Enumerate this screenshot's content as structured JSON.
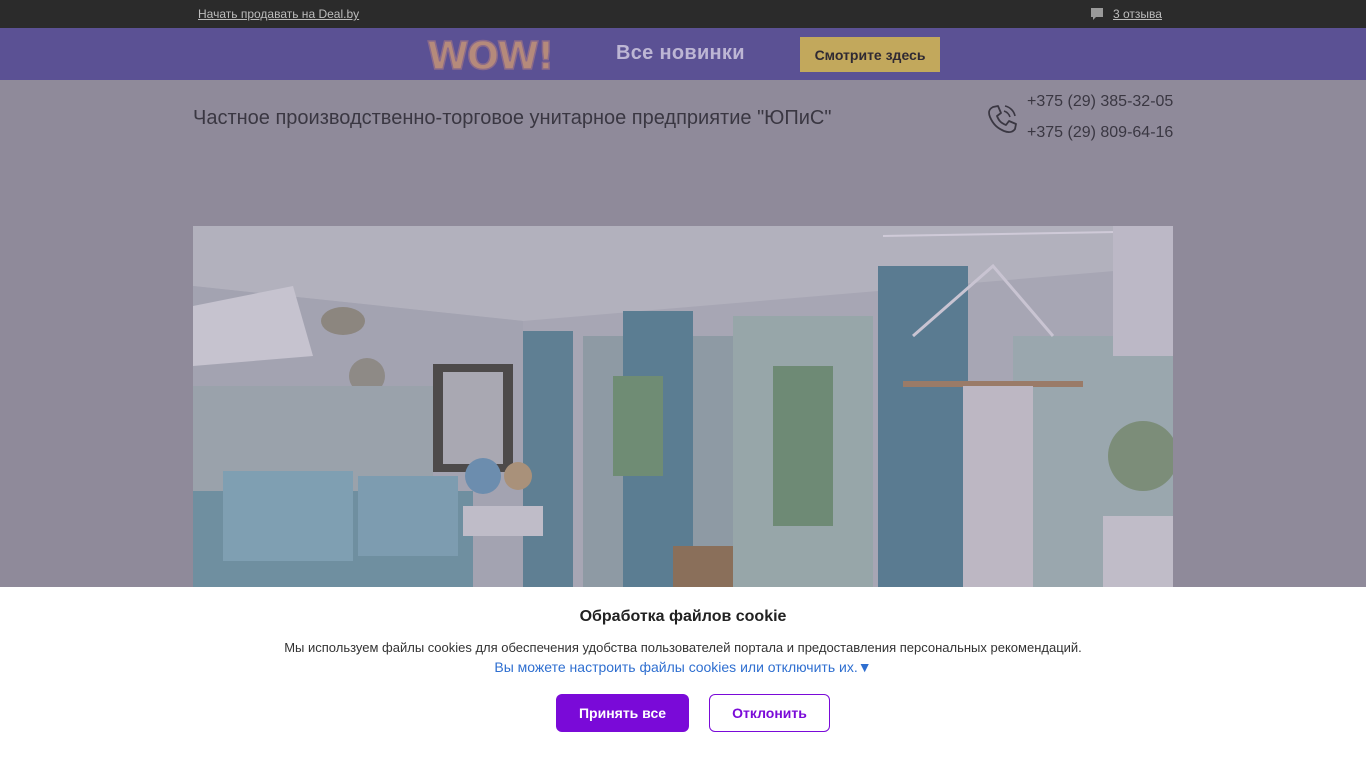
{
  "topbar": {
    "sell_link": "Начать продавать на Deal.by",
    "reviews_icon": "speech-bubble-icon",
    "reviews_link": "3 отзыва"
  },
  "promo": {
    "logo_text": "WOW!",
    "text": "Все новинки",
    "button": "Смотрите здесь",
    "accent_color": "#c2a85c"
  },
  "header": {
    "company_name": "Частное производственно-торговое унитарное предприятие \"ЮПиС\"",
    "phone_icon": "phone-icon",
    "phones": [
      "+375 (29) 385-32-05",
      "+375 (29) 809-64-16"
    ]
  },
  "hero": {
    "image": "bedroom-banner"
  },
  "cookie": {
    "title": "Обработка файлов cookie",
    "text": "Мы используем файлы cookies для обеспечения удобства пользователей портала и предоставления персональных рекомендаций.",
    "settings_link": "Вы можете настроить файлы cookies или отключить их.▼",
    "accept": "Принять все",
    "decline": "Отклонить",
    "accent_color": "#7a0ad8"
  }
}
